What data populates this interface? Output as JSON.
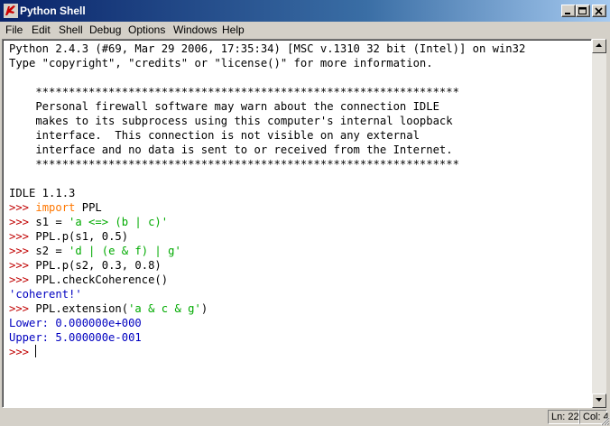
{
  "window": {
    "title": "Python Shell"
  },
  "menubar": {
    "items": [
      "File",
      "Edit",
      "Shell",
      "Debug",
      "Options",
      "Windows",
      "Help"
    ]
  },
  "shell": {
    "lines": [
      [
        {
          "t": "Python 2.4.3 (#69, Mar 29 2006, 17:35:34) [MSC v.1310 32 bit (Intel)] on win32",
          "c": ""
        }
      ],
      [
        {
          "t": "Type \"copyright\", \"credits\" or \"license()\" for more information.",
          "c": ""
        }
      ],
      [
        {
          "t": "",
          "c": ""
        }
      ],
      [
        {
          "t": "    ****************************************************************",
          "c": ""
        }
      ],
      [
        {
          "t": "    Personal firewall software may warn about the connection IDLE",
          "c": ""
        }
      ],
      [
        {
          "t": "    makes to its subprocess using this computer's internal loopback",
          "c": ""
        }
      ],
      [
        {
          "t": "    interface.  This connection is not visible on any external",
          "c": ""
        }
      ],
      [
        {
          "t": "    interface and no data is sent to or received from the Internet.",
          "c": ""
        }
      ],
      [
        {
          "t": "    ****************************************************************",
          "c": ""
        }
      ],
      [
        {
          "t": "",
          "c": ""
        }
      ],
      [
        {
          "t": "IDLE 1.1.3",
          "c": ""
        }
      ],
      [
        {
          "t": ">>> ",
          "c": "prompt"
        },
        {
          "t": "import",
          "c": "kw"
        },
        {
          "t": " PPL",
          "c": ""
        }
      ],
      [
        {
          "t": ">>> ",
          "c": "prompt"
        },
        {
          "t": "s1 = ",
          "c": ""
        },
        {
          "t": "'a <=> (b | c)'",
          "c": "str"
        }
      ],
      [
        {
          "t": ">>> ",
          "c": "prompt"
        },
        {
          "t": "PPL.p(s1, 0.5)",
          "c": ""
        }
      ],
      [
        {
          "t": ">>> ",
          "c": "prompt"
        },
        {
          "t": "s2 = ",
          "c": ""
        },
        {
          "t": "'d | (e & f) | g'",
          "c": "str"
        }
      ],
      [
        {
          "t": ">>> ",
          "c": "prompt"
        },
        {
          "t": "PPL.p(s2, 0.3, 0.8)",
          "c": ""
        }
      ],
      [
        {
          "t": ">>> ",
          "c": "prompt"
        },
        {
          "t": "PPL.checkCoherence()",
          "c": ""
        }
      ],
      [
        {
          "t": "'coherent!'",
          "c": "out"
        }
      ],
      [
        {
          "t": ">>> ",
          "c": "prompt"
        },
        {
          "t": "PPL.extension(",
          "c": ""
        },
        {
          "t": "'a & c & g'",
          "c": "str"
        },
        {
          "t": ")",
          "c": ""
        }
      ],
      [
        {
          "t": "Lower: 0.000000e+000",
          "c": "out"
        }
      ],
      [
        {
          "t": "Upper: 5.000000e-001",
          "c": "out"
        }
      ],
      [
        {
          "t": ">>> ",
          "c": "prompt"
        }
      ]
    ]
  },
  "status": {
    "line": "Ln: 22",
    "col": "Col: 4"
  },
  "colors": {
    "keyword": "#ff7700",
    "string": "#00aa00",
    "prompt": "#c00000",
    "output": "#0000c0",
    "titlebar_start": "#0a246a",
    "titlebar_end": "#a6caf0"
  },
  "icons": {
    "app": "tk-feather-icon",
    "minimize": "minimize-icon",
    "maximize": "maximize-icon",
    "close": "close-icon",
    "scroll_up": "arrow-up-icon",
    "scroll_down": "arrow-down-icon",
    "grip": "resize-grip-icon"
  }
}
